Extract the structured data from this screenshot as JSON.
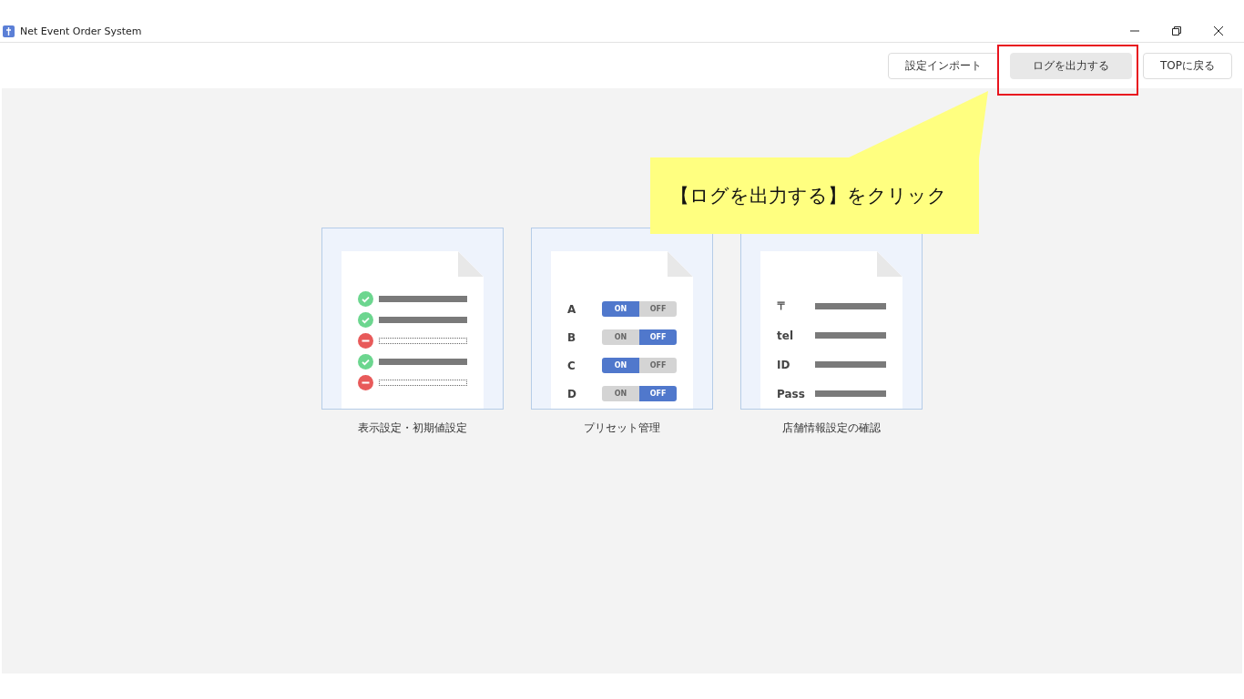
{
  "window": {
    "title": "Net Event Order System"
  },
  "toolbar": {
    "buttons": [
      {
        "label": "設定インポート",
        "highlighted": false
      },
      {
        "label": "ログを出力する",
        "highlighted": true
      },
      {
        "label": "TOPに戻る",
        "highlighted": false
      }
    ]
  },
  "callout": {
    "text": "【ログを出力する】をクリック"
  },
  "cards": [
    {
      "kind": "checklist",
      "caption": "表示設定・初期値設定",
      "rows": [
        {
          "ok": true
        },
        {
          "ok": true
        },
        {
          "ok": false
        },
        {
          "ok": true
        },
        {
          "ok": false
        }
      ]
    },
    {
      "kind": "toggles",
      "caption": "プリセット管理",
      "rows": [
        {
          "label": "A",
          "on": true,
          "on_label": "ON",
          "off_label": "OFF"
        },
        {
          "label": "B",
          "on": false,
          "on_label": "ON",
          "off_label": "OFF"
        },
        {
          "label": "C",
          "on": true,
          "on_label": "ON",
          "off_label": "OFF"
        },
        {
          "label": "D",
          "on": false,
          "on_label": "ON",
          "off_label": "OFF"
        }
      ]
    },
    {
      "kind": "fields",
      "caption": "店舗情報設定の確認",
      "rows": [
        {
          "label": "〒"
        },
        {
          "label": "tel"
        },
        {
          "label": "ID"
        },
        {
          "label": "Pass"
        }
      ]
    }
  ]
}
